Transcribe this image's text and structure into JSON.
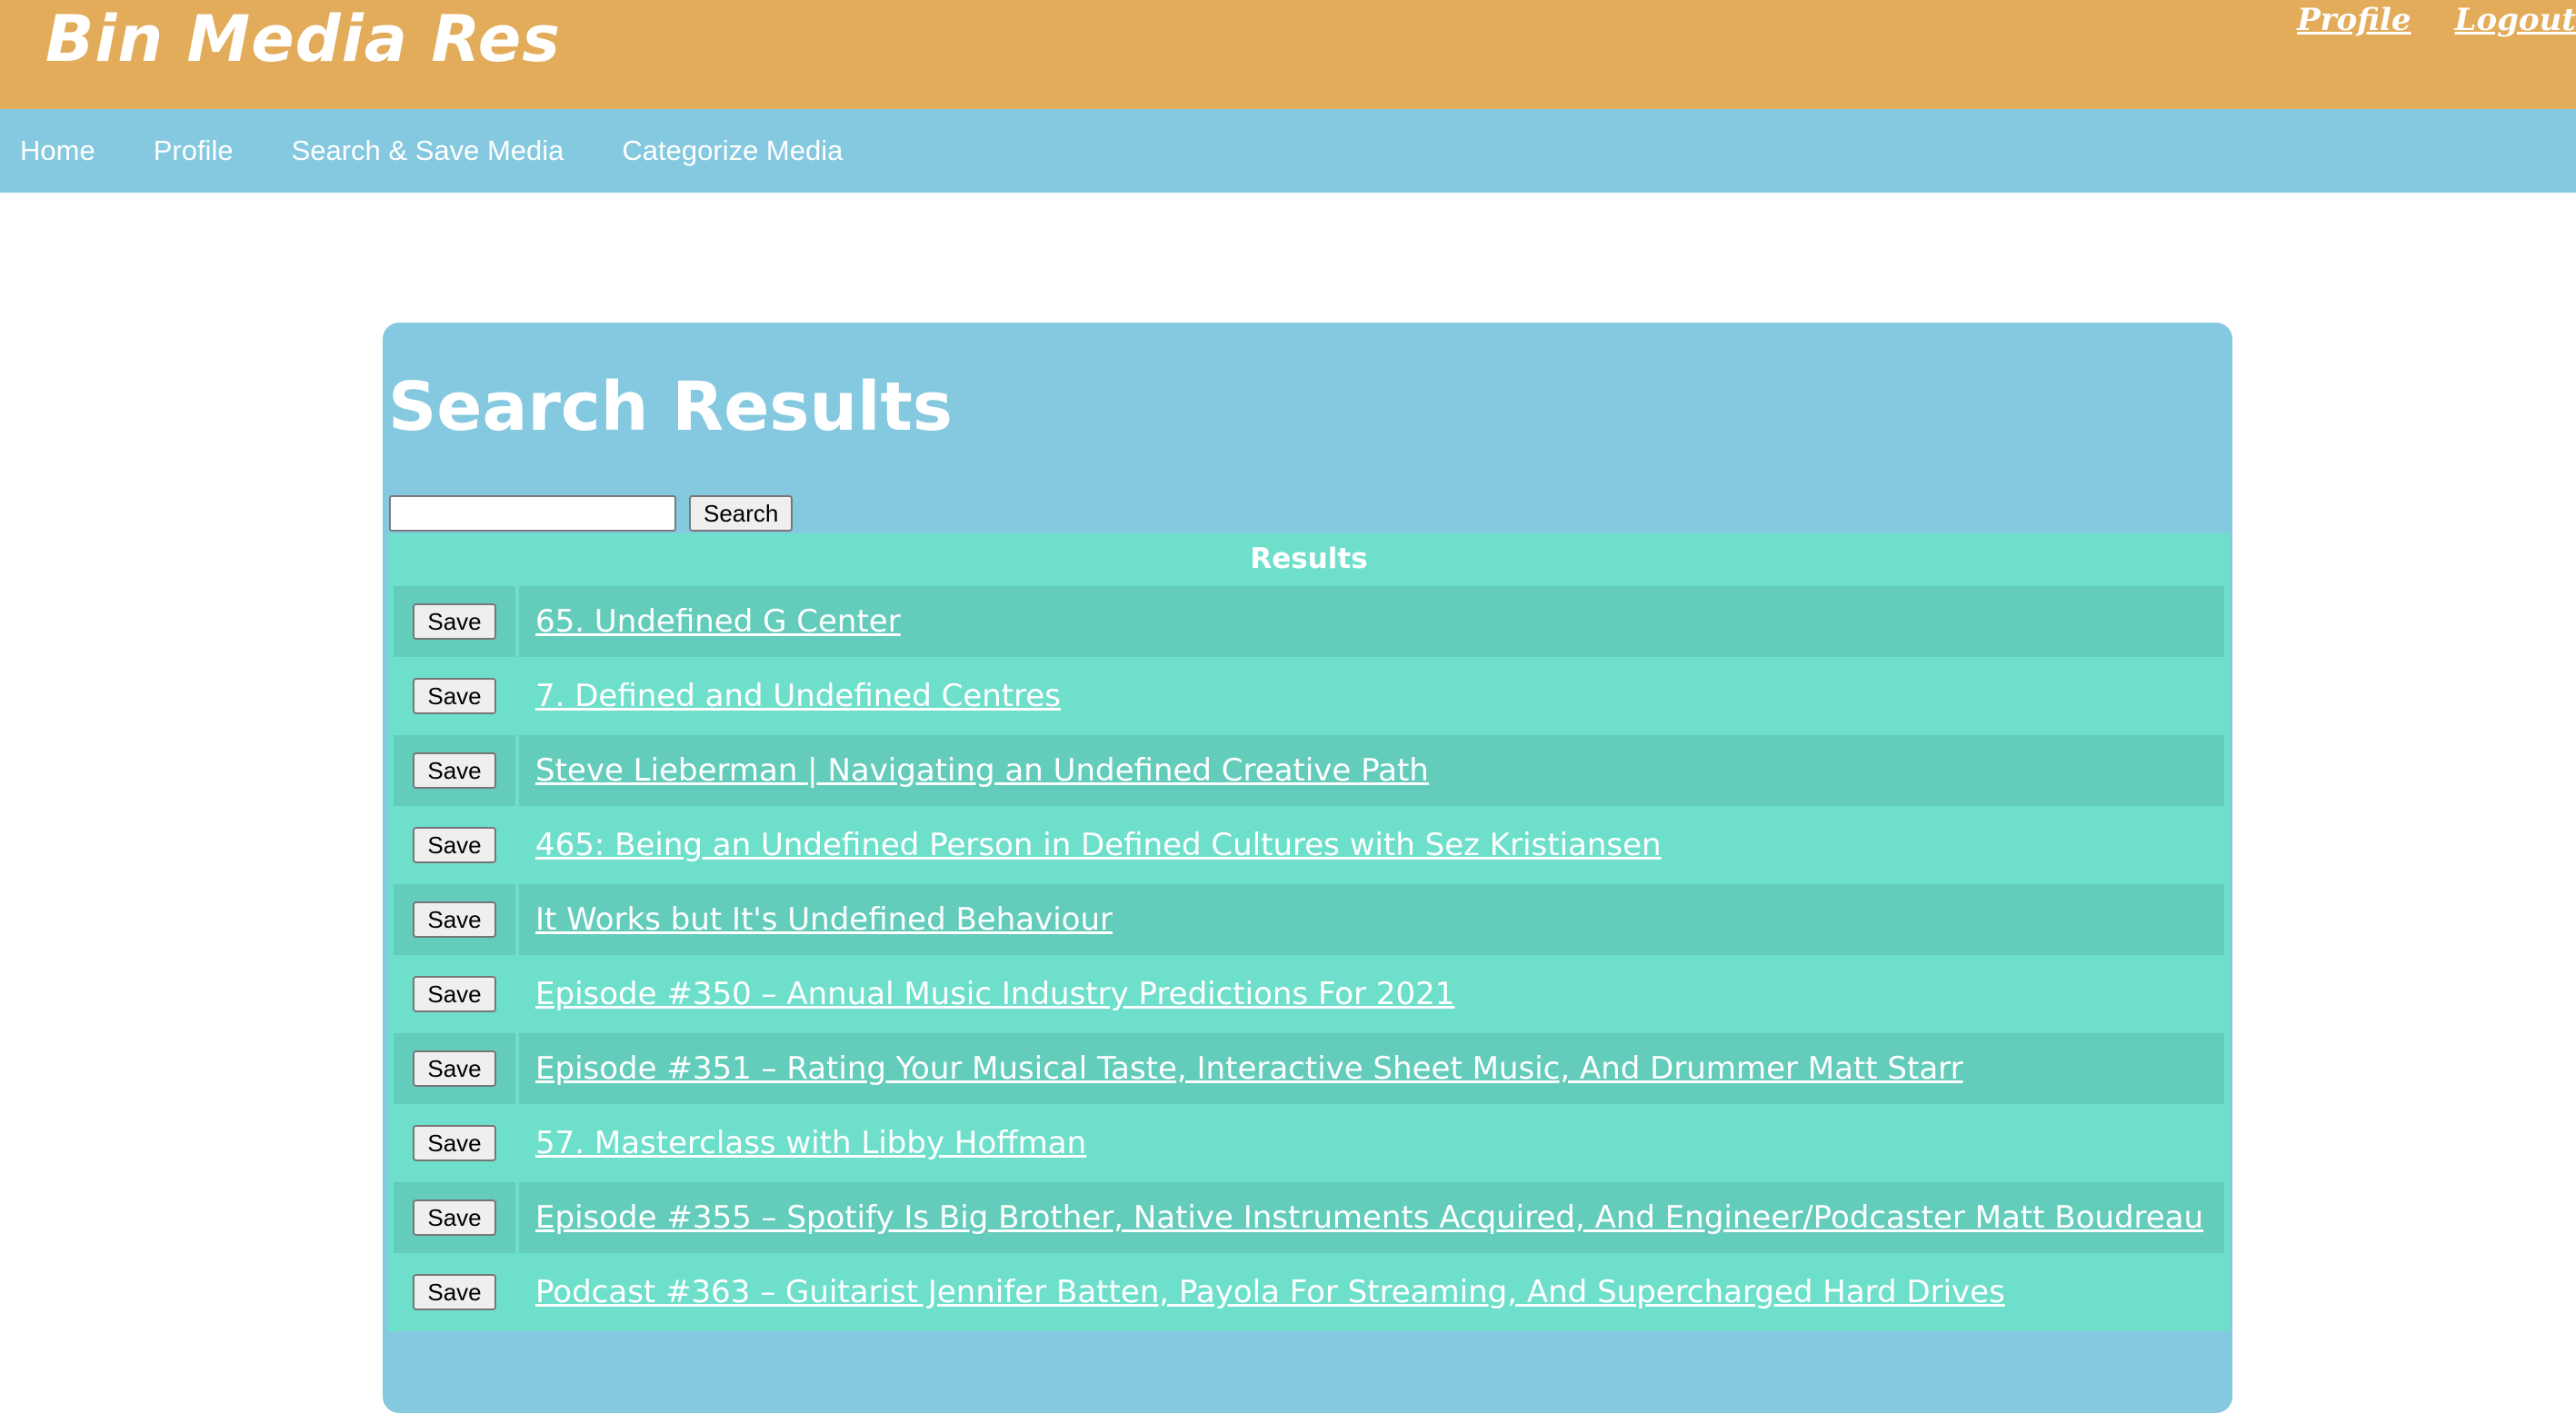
{
  "header": {
    "brand": "Bin Media Res",
    "links": [
      "Profile",
      "Logout"
    ]
  },
  "nav": {
    "items": [
      "Home",
      "Profile",
      "Search & Save Media",
      "Categorize Media"
    ]
  },
  "main": {
    "title": "Search Results",
    "search": {
      "value": "",
      "placeholder": "",
      "button_label": "Search"
    },
    "results_header": "Results",
    "save_label": "Save",
    "results": [
      "65. Undefined G Center",
      "7. Defined and Undefined Centres",
      "Steve Lieberman | Navigating an Undefined Creative Path",
      "465: Being an Undefined Person in Defined Cultures with Sez Kristiansen",
      "It Works but It's Undefined Behaviour",
      "Episode #350 – Annual Music Industry Predictions For 2021",
      "Episode #351 – Rating Your Musical Taste, Interactive Sheet Music, And Drummer Matt Starr",
      "57. Masterclass with Libby Hoffman",
      "Episode #355 – Spotify Is Big Brother, Native Instruments Acquired, And Engineer/Podcaster Matt Boudreau",
      "Podcast #363 – Guitarist Jennifer Batten, Payola For Streaming, And Supercharged Hard Drives"
    ]
  },
  "colors": {
    "header_bg": "#e2ac5b",
    "nav_bg": "#84c9df",
    "results_bg": "#6edfcb",
    "results_row_alt": "#63ccbb"
  }
}
